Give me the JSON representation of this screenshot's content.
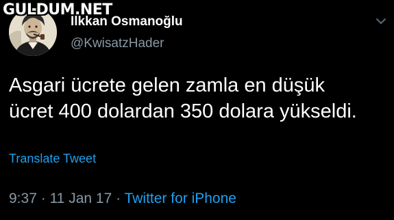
{
  "watermark": {
    "text": "GULDUM.NET"
  },
  "user": {
    "display_name": "İlkkan Osmanoğlu",
    "handle": "@KwisatzHader"
  },
  "tweet": {
    "text_line1": "Asgari ücrete gelen zamla en düşük",
    "text_line2": "ücret 400 dolardan 350 dolara yükseldi.",
    "translate_label": "Translate Tweet",
    "time": "9:37",
    "separator": "·",
    "date": "11 Jan 17",
    "source": "Twitter for iPhone"
  },
  "icons": {
    "menu": "chevron-down-icon",
    "avatar": "avatar-portrait"
  },
  "colors": {
    "background": "#000000",
    "text_primary": "#ffffff",
    "text_secondary": "#8899a6",
    "link": "#1da1f2"
  }
}
